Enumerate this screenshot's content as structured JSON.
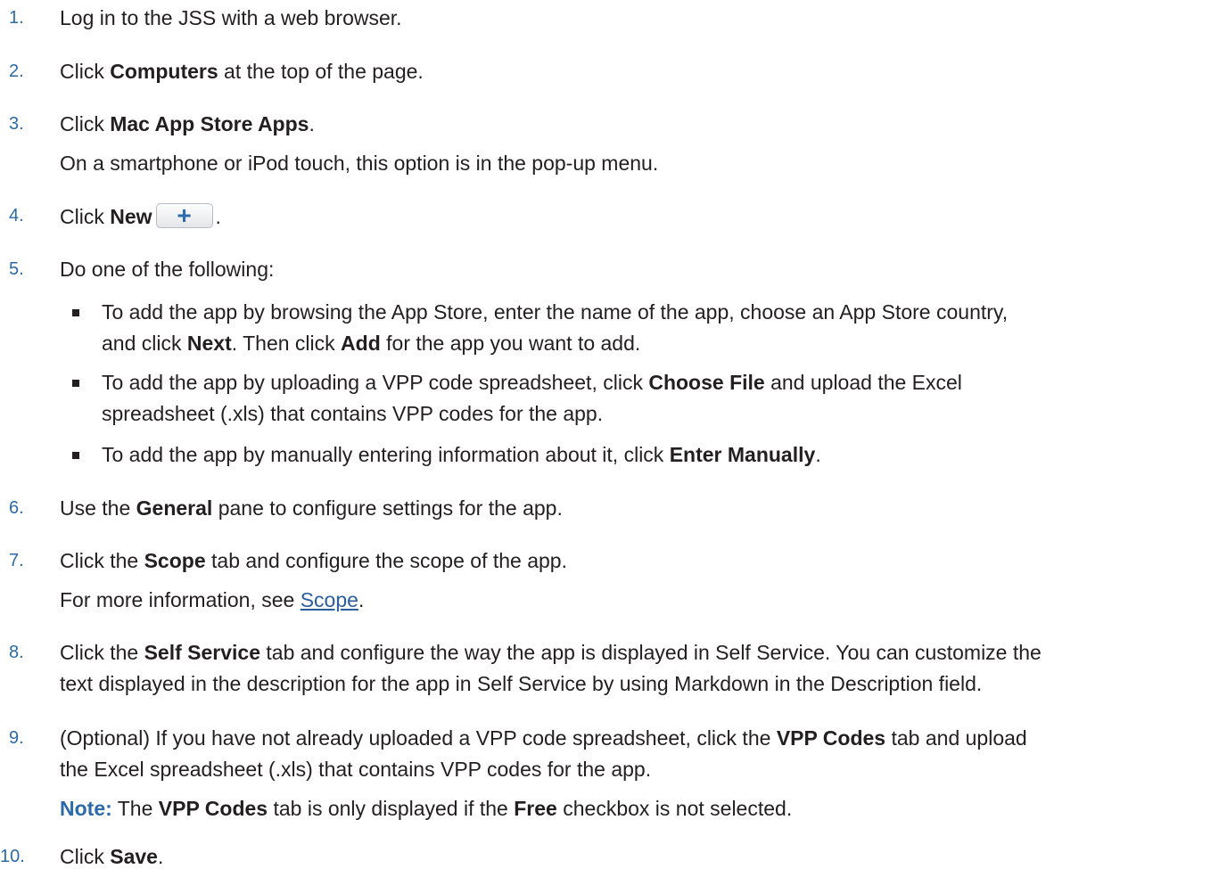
{
  "steps": [
    {
      "num": "1.",
      "parts": {
        "a": "Log in to the JSS with a web browser."
      }
    },
    {
      "num": "2.",
      "parts": {
        "a": "Click ",
        "b": "Computers",
        "c": " at the top of the page."
      }
    },
    {
      "num": "3.",
      "parts": {
        "a": "Click ",
        "b": "Mac App Store Apps",
        "c": "."
      },
      "sub": "On a smartphone or iPod touch, this option is in the pop-up menu."
    },
    {
      "num": "4.",
      "parts": {
        "a": "Click ",
        "b": "New",
        "c": "."
      },
      "button_glyph": "+"
    },
    {
      "num": "5.",
      "parts": {
        "a": "Do one of the following:"
      }
    },
    {
      "num": "6.",
      "parts": {
        "a": "Use the ",
        "b": "General",
        "c": " pane to configure settings for the app."
      }
    },
    {
      "num": "7.",
      "parts": {
        "a": "Click the ",
        "b": "Scope",
        "c": " tab and configure the scope of the app."
      },
      "sub": {
        "a": "For more information, see ",
        "link": "Scope",
        "c": "."
      }
    },
    {
      "num": "8.",
      "parts": {
        "a": "Click the ",
        "b": "Self Service",
        "c": " tab and configure the way the app is displayed in Self Service. You can customize the"
      },
      "line2": "text displayed in the description for the app in Self Service by using Markdown in the Description field."
    },
    {
      "num": "9.",
      "parts": {
        "a": "(Optional) If you have not already uploaded a VPP code spreadsheet, click the ",
        "b": "VPP Codes",
        "c": " tab and upload"
      },
      "line2": "the Excel spreadsheet (.xls) that contains VPP codes for the app.",
      "note": {
        "label": "Note:",
        "a": " The ",
        "b": "VPP Codes",
        "c": " tab is only displayed if the ",
        "d": "Free",
        "e": " checkbox is not selected."
      }
    },
    {
      "num": "10.",
      "parts": {
        "a": "Click ",
        "b": "Save",
        "c": "."
      }
    }
  ],
  "bullets": [
    {
      "l1a": "To add the app by browsing the App Store, enter the name of the app, choose an App Store country,",
      "l2a": "and click ",
      "l2b": "Next",
      "l2c": ". Then click ",
      "l2d": "Add",
      "l2e": " for the app you want to add."
    },
    {
      "l1a": "To add the app by uploading a VPP code spreadsheet, click ",
      "l1b": "Choose File",
      "l1c": " and upload the Excel",
      "l2a": "spreadsheet (.xls) that contains VPP codes for the app."
    },
    {
      "l1a": "To add the app by manually entering information about it, click ",
      "l1b": "Enter Manually",
      "l1c": "."
    }
  ]
}
